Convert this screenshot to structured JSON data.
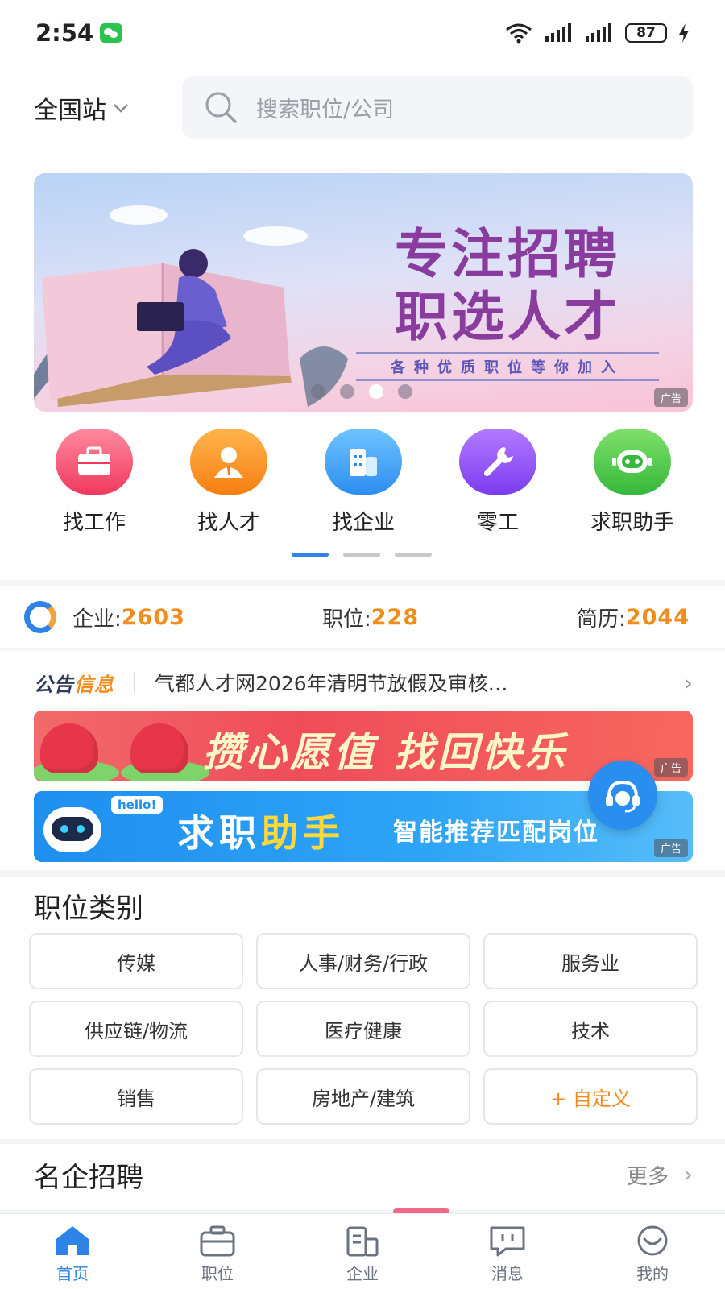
{
  "status_bar": {
    "time": "2:54",
    "battery": "87",
    "icons": [
      "wechat-icon",
      "wifi-icon",
      "signal-icon",
      "signal-icon",
      "battery-icon",
      "charging-icon"
    ]
  },
  "header": {
    "site_label": "全国站",
    "search_placeholder": "搜索职位/公司"
  },
  "banner": {
    "title_line1": "专注招聘",
    "title_line2": "职选人才",
    "subtitle": "各种优质职位等你加入",
    "ad_tag": "广告",
    "dots_count": 4,
    "active_dot": 3
  },
  "quick_nav": [
    {
      "label": "找工作",
      "icon": "briefcase-icon",
      "color": "#f0395e"
    },
    {
      "label": "找人才",
      "icon": "person-icon",
      "color": "#f77f12"
    },
    {
      "label": "找企业",
      "icon": "building-icon",
      "color": "#2e8ef0"
    },
    {
      "label": "零工",
      "icon": "wrench-icon",
      "color": "#7b3cf0"
    },
    {
      "label": "求职助手",
      "icon": "robot-icon",
      "color": "#36b83c"
    }
  ],
  "stats": {
    "company_label": "企业:",
    "company_value": "2603",
    "position_label": "职位:",
    "position_value": "228",
    "resume_label": "简历:",
    "resume_value": "2044"
  },
  "notice": {
    "logo_part1": "公告",
    "logo_part2": "信息",
    "text": "气都人才网2026年清明节放假及审核…"
  },
  "promos": {
    "red_text": "攒心愿值 找回快乐",
    "red_ad": "广告",
    "blue_hello": "hello!",
    "blue_text_a": "求职",
    "blue_text_b": "助手",
    "blue_text_c": "智能推荐匹配岗位",
    "blue_ad": "广告"
  },
  "categories": {
    "title": "职位类别",
    "items": [
      "传媒",
      "人事/财务/行政",
      "服务业",
      "供应链/物流",
      "医疗健康",
      "技术",
      "销售",
      "房地产/建筑",
      "+ 自定义"
    ]
  },
  "famous": {
    "title": "名企招聘",
    "more": "更多"
  },
  "bottom_nav": [
    {
      "label": "首页",
      "icon": "home-icon",
      "active": true
    },
    {
      "label": "职位",
      "icon": "briefcase-icon",
      "active": false
    },
    {
      "label": "企业",
      "icon": "building-icon",
      "active": false
    },
    {
      "label": "消息",
      "icon": "message-icon",
      "active": false
    },
    {
      "label": "我的",
      "icon": "profile-icon",
      "active": false
    }
  ],
  "colors": {
    "accent": "#2f83e6",
    "highlight": "#f28c1c"
  }
}
